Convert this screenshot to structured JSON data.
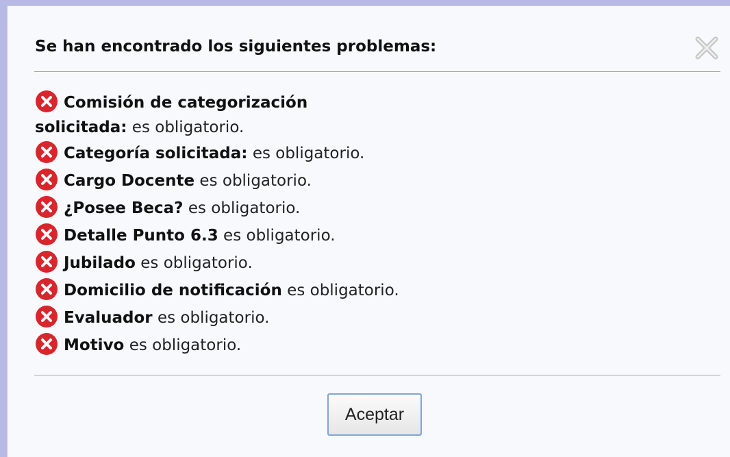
{
  "dialog": {
    "title": "Se han encontrado los siguientes problemas:",
    "close_icon": "close-x-icon",
    "error_icon": "error-circle-x-icon",
    "accent_error_color": "#d8262c",
    "errors": [
      {
        "field": "Comisión de categorización solicitada:",
        "message": "es obligatorio."
      },
      {
        "field": "Categoría solicitada:",
        "message": "es obligatorio."
      },
      {
        "field": "Cargo Docente",
        "message": "es obligatorio."
      },
      {
        "field": "¿Posee Beca?",
        "message": "es obligatorio."
      },
      {
        "field": "Detalle Punto 6.3",
        "message": "es obligatorio."
      },
      {
        "field": "Jubilado",
        "message": "es obligatorio."
      },
      {
        "field": "Domicilio de notificación",
        "message": "es obligatorio."
      },
      {
        "field": "Evaluador",
        "message": "es obligatorio."
      },
      {
        "field": "Motivo",
        "message": "es obligatorio."
      }
    ],
    "accept_label": "Aceptar"
  }
}
